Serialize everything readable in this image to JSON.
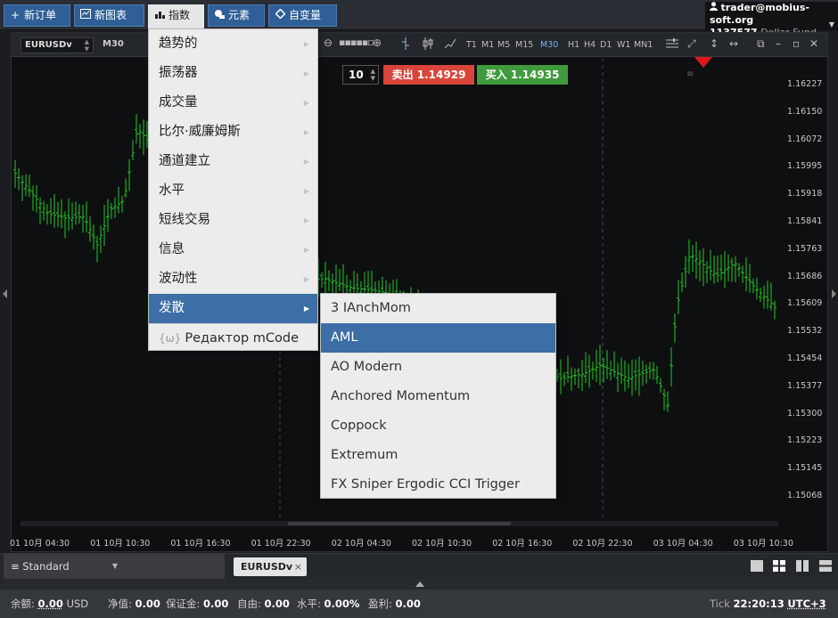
{
  "toolbar": {
    "new_order": "新订单",
    "new_chart": "新图表",
    "indicators": "指数",
    "elements": "元素",
    "variables": "自变量"
  },
  "account": {
    "user": "trader@mobius-soft.org",
    "number": "1137577",
    "fund": "Dollar Fund"
  },
  "chart": {
    "symbol": "EURUSDv",
    "timeframe": "M30",
    "timeframes": [
      "T1",
      "M1",
      "M5",
      "M15",
      "M30",
      "H1",
      "H4",
      "D1",
      "W1",
      "MN1"
    ],
    "selected_timeframe": "M30",
    "lot": "10",
    "sell_label": "卖出 1.14929",
    "buy_label": "买入 1.14935",
    "prices": [
      "1.16227",
      "1.16150",
      "1.16072",
      "1.15995",
      "1.15918",
      "1.15841",
      "1.15763",
      "1.15686",
      "1.15609",
      "1.15532",
      "1.15454",
      "1.15377",
      "1.15300",
      "1.15223",
      "1.15145",
      "1.15068"
    ],
    "times": [
      "01 10月 04:30",
      "01 10月 10:30",
      "01 10月 16:30",
      "01 10月 22:30",
      "02 10月 04:30",
      "02 10月 10:30",
      "02 10月 16:30",
      "02 10月 22:30",
      "03 10月 04:30",
      "03 10月 10:30"
    ],
    "colors": {
      "up": "#22c922",
      "down": "#22c922",
      "sell": "#d9453a",
      "buy": "#3f9b3b",
      "accent": "#3d6ea6",
      "marker": "#e0161e"
    }
  },
  "indicator_menu": {
    "items": [
      "趋势的",
      "振荡器",
      "成交量",
      "比尔·威廉姆斯",
      "通道建立",
      "水平",
      "短线交易",
      "信息",
      "波动性",
      "发散"
    ],
    "highlighted": "发散",
    "editor": "Редактор mCode"
  },
  "divergence_submenu": {
    "items": [
      "3 IAnchMom",
      "AML",
      "AO Modern",
      "Anchored Momentum",
      "Coppock",
      "Extremum",
      "FX Sniper Ergodic CCI Trigger"
    ],
    "highlighted": "AML"
  },
  "bottom": {
    "workspace": "Standard",
    "chart_tab": "EURUSDv"
  },
  "status": {
    "balance_label": "余额:",
    "balance_value": "0.00",
    "balance_currency": "USD",
    "equity_label": "净值:",
    "equity_value": "0.00",
    "margin_label": "保证金:",
    "margin_value": "0.00",
    "free_label": "自由:",
    "free_value": "0.00",
    "level_label": "水平:",
    "level_value": "0.00%",
    "profit_label": "盈利:",
    "profit_value": "0.00",
    "tick_label": "Tick",
    "time": "22:20:13",
    "timezone": "UTC+3"
  }
}
